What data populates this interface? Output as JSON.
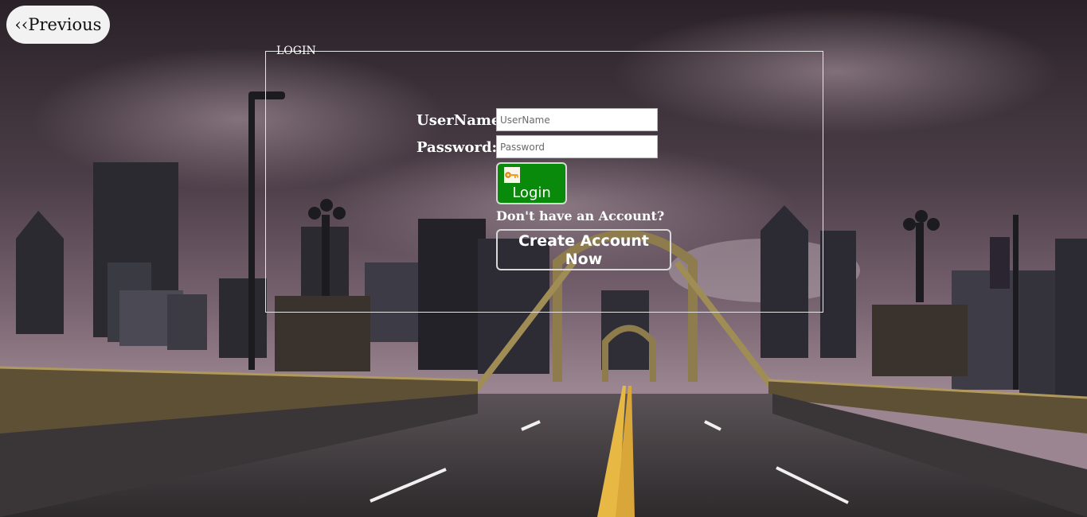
{
  "nav": {
    "previous_label": "‹‹Previous"
  },
  "login": {
    "legend": "LOGIN",
    "username_label": "UserName:",
    "username_placeholder": "UserName",
    "password_label": "Password:",
    "password_placeholder": "Password",
    "login_label": "Login",
    "login_icon": "key-icon",
    "no_account_text": "Don't have an Account?",
    "create_account_label": "Create Account Now"
  },
  "colors": {
    "login_button": "#0a8a0a",
    "text": "#ffffff",
    "previous_button": "#f2f2f2"
  }
}
